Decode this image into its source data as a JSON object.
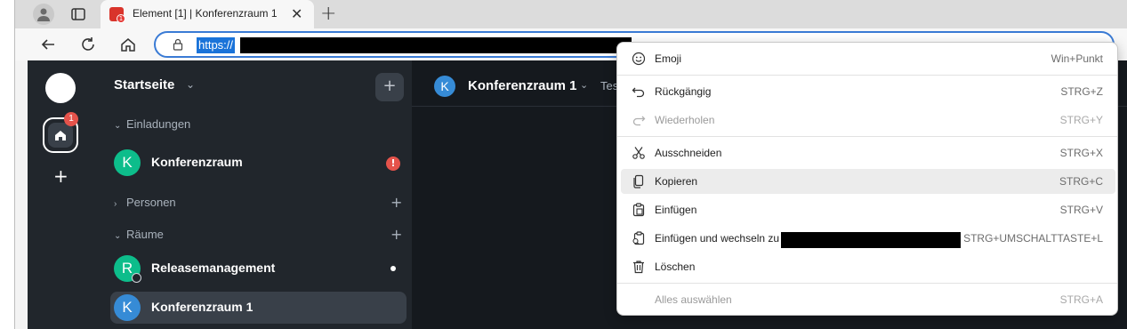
{
  "browser": {
    "tab": {
      "title": "Element [1] | Konferenzraum 1",
      "favicon_badge": "1"
    },
    "address": {
      "url_visible": "https://"
    }
  },
  "spaces": {
    "home_badge": "1"
  },
  "sidebar": {
    "title": "Startseite",
    "sections": [
      {
        "label": "Einladungen"
      },
      {
        "label": "Personen"
      },
      {
        "label": "Räume"
      }
    ],
    "rooms": [
      {
        "initial": "K",
        "name": "Konferenzraum",
        "color": "#0dbd8b",
        "alert": "!"
      },
      {
        "initial": "R",
        "name": "Releasemanagement",
        "color": "#0dbd8b"
      },
      {
        "initial": "K",
        "name": "Konferenzraum 1",
        "color": "#368bd6"
      }
    ]
  },
  "room_header": {
    "initial": "K",
    "title": "Konferenzraum 1",
    "topic": "Test"
  },
  "context_menu": {
    "items": [
      {
        "icon": "emoji-icon",
        "label": "Emoji",
        "shortcut": "Win+Punkt",
        "enabled": true
      },
      {
        "icon": "undo-icon",
        "label": "Rückgängig",
        "shortcut": "STRG+Z",
        "enabled": true
      },
      {
        "icon": "redo-icon",
        "label": "Wiederholen",
        "shortcut": "STRG+Y",
        "enabled": false
      },
      {
        "icon": "cut-icon",
        "label": "Ausschneiden",
        "shortcut": "STRG+X",
        "enabled": true
      },
      {
        "icon": "copy-icon",
        "label": "Kopieren",
        "shortcut": "STRG+C",
        "enabled": true,
        "hovered": true
      },
      {
        "icon": "paste-icon",
        "label": "Einfügen",
        "shortcut": "STRG+V",
        "enabled": true
      },
      {
        "icon": "paste-go-icon",
        "label": "Einfügen und wechseln zu",
        "shortcut": "STRG+UMSCHALTTASTE+L",
        "enabled": true
      },
      {
        "icon": "trash-icon",
        "label": "Löschen",
        "shortcut": "",
        "enabled": true
      },
      {
        "icon": "",
        "label": "Alles auswählen",
        "shortcut": "STRG+A",
        "enabled": false
      }
    ]
  }
}
